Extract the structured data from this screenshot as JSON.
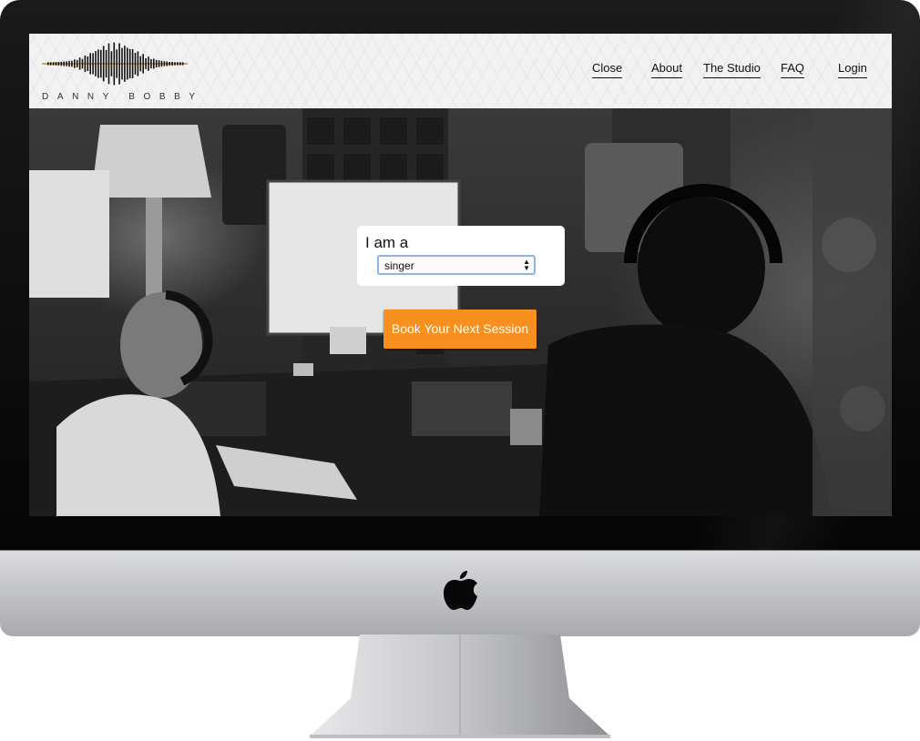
{
  "brand": {
    "name": "DANNY BOBBY",
    "accent": "#f7901e"
  },
  "nav": {
    "items": [
      {
        "label": "Close"
      },
      {
        "label": "About"
      },
      {
        "label": "The Studio"
      },
      {
        "label": "FAQ"
      },
      {
        "label": "Login"
      }
    ]
  },
  "hero": {
    "selector_label": "I am a",
    "selector_value": "singer",
    "book_button_label": "Book Your Next Session"
  },
  "device": {
    "logo_icon": "apple-logo-icon"
  }
}
